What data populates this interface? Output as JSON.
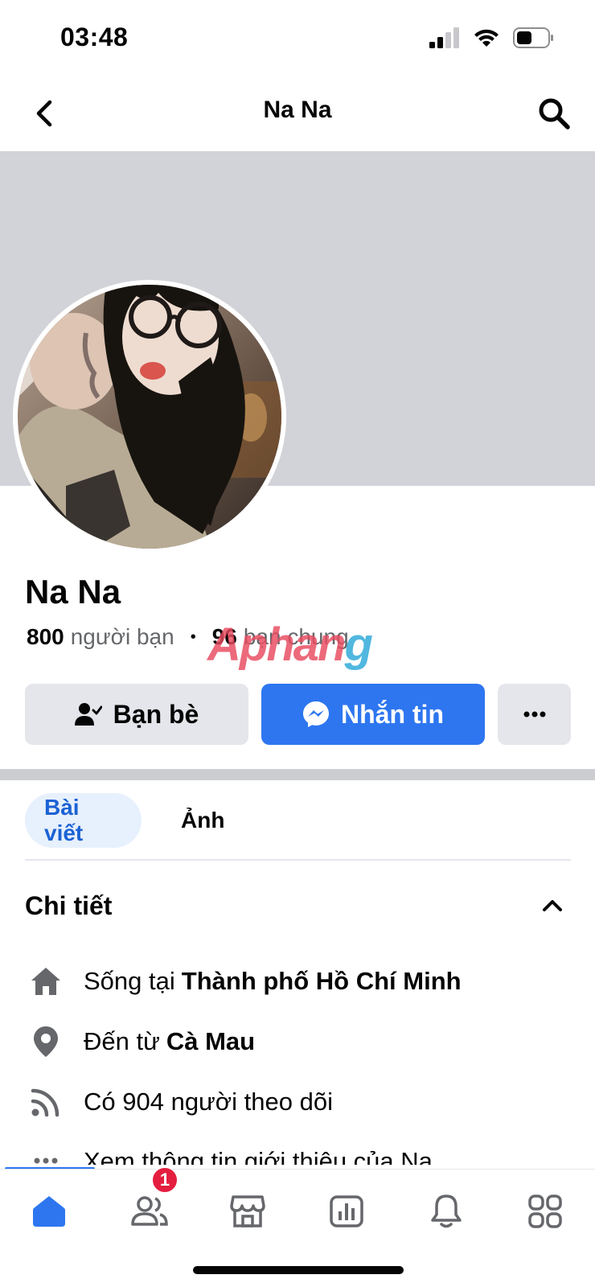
{
  "status": {
    "time": "03:48"
  },
  "nav": {
    "title": "Na Na"
  },
  "profile": {
    "name": "Na Na",
    "friends_count": "800",
    "friends_label": "người bạn",
    "mutual_count": "96",
    "mutual_label": "bạn chung"
  },
  "watermark": {
    "part1": "Aphan",
    "part2": "g"
  },
  "actions": {
    "friends_label": "Bạn bè",
    "message_label": "Nhắn tin"
  },
  "tabs": [
    {
      "label": "Bài viết"
    },
    {
      "label": "Ảnh"
    }
  ],
  "details": {
    "title": "Chi tiết",
    "lives_prefix": "Sống tại",
    "lives_place": "Thành phố Hồ Chí Minh",
    "from_prefix": "Đến từ",
    "from_place": "Cà Mau",
    "followers": "Có 904 người theo dõi",
    "about": "Xem thông tin giới thiệu của Na"
  },
  "bottom_nav": {
    "friends_badge": "1"
  },
  "colors": {
    "accent": "#2d76f0",
    "cover": "#d1d3d8",
    "badge": "#e41e3f"
  }
}
